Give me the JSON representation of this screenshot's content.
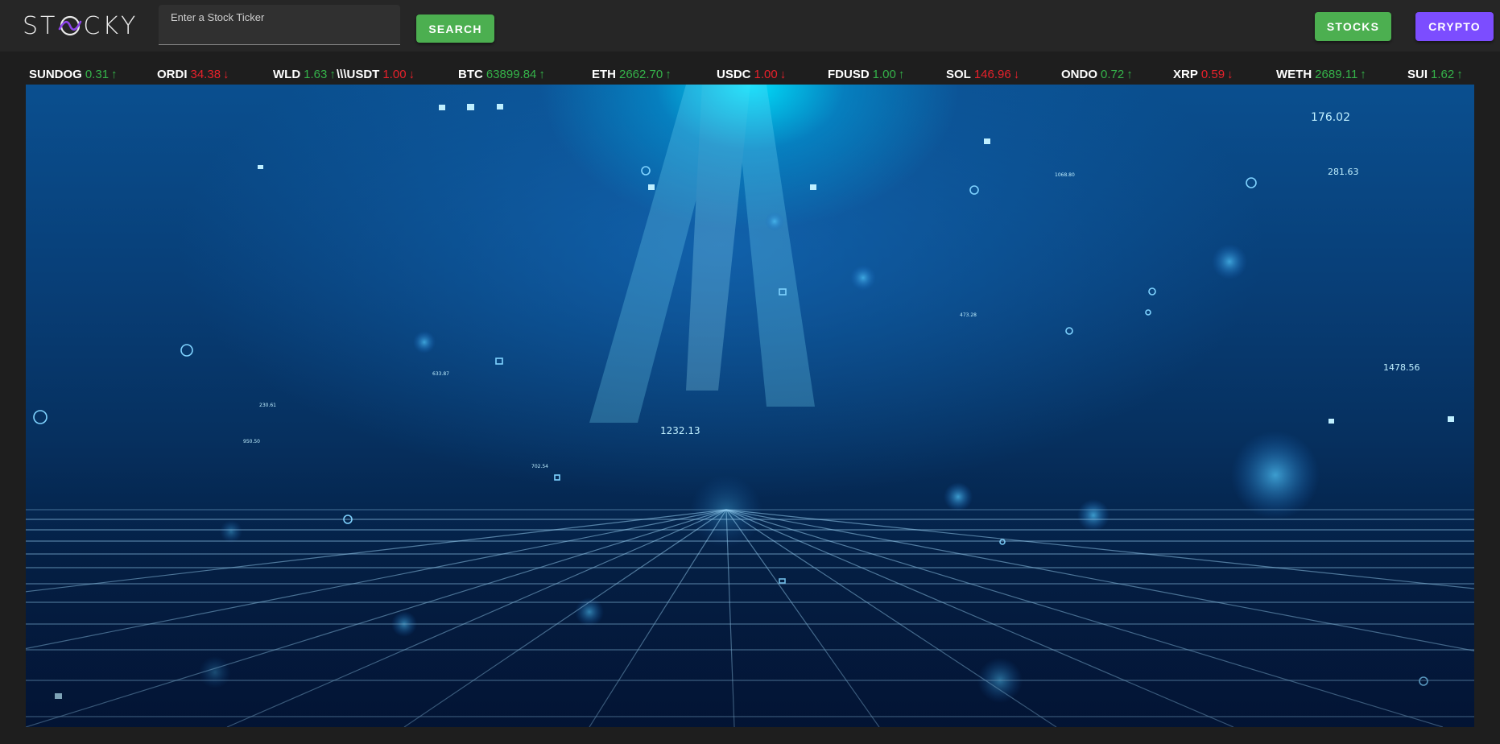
{
  "brand": {
    "logo_text_left": "ST",
    "logo_text_right": "CKY"
  },
  "search": {
    "label": "Enter a Stock Ticker",
    "value": "",
    "button_label": "SEARCH"
  },
  "nav": {
    "stocks_label": "STOCKS",
    "crypto_label": "CRYPTO",
    "colors": {
      "stocks": "#4caf50",
      "crypto": "#7c4dff"
    }
  },
  "ticker": [
    {
      "symbol": "SUNDOG",
      "value": "0.31",
      "trend": "up",
      "arrow": "↑"
    },
    {
      "symbol": "ORDI",
      "value": "34.38",
      "trend": "down",
      "arrow": "↓"
    },
    {
      "symbol": "WLD",
      "value": "1.63",
      "trend": "up",
      "arrow": "↑"
    },
    {
      "symbol": "\\\\\\USDT",
      "value": "1.00",
      "trend": "down",
      "arrow": "↓"
    },
    {
      "symbol": "BTC",
      "value": "63899.84",
      "trend": "up",
      "arrow": "↑"
    },
    {
      "symbol": "ETH",
      "value": "2662.70",
      "trend": "up",
      "arrow": "↑"
    },
    {
      "symbol": "USDC",
      "value": "1.00",
      "trend": "down",
      "arrow": "↓"
    },
    {
      "symbol": "FDUSD",
      "value": "1.00",
      "trend": "up",
      "arrow": "↑"
    },
    {
      "symbol": "SOL",
      "value": "146.96",
      "trend": "down",
      "arrow": "↓"
    },
    {
      "symbol": "ONDO",
      "value": "0.72",
      "trend": "up",
      "arrow": "↑"
    },
    {
      "symbol": "XRP",
      "value": "0.59",
      "trend": "down",
      "arrow": "↓"
    },
    {
      "symbol": "WETH",
      "value": "2689.11",
      "trend": "up",
      "arrow": "↑"
    },
    {
      "symbol": "SUI",
      "value": "1.62",
      "trend": "up",
      "arrow": "↑"
    }
  ],
  "hero": {
    "floating_numbers": [
      "176.02",
      "281.63",
      "1478.56",
      "1232.13",
      "633.87",
      "230.61",
      "950.50",
      "702.54",
      "473.28",
      "1068.80"
    ]
  },
  "colors": {
    "up": "#35b34a",
    "down": "#e8212b",
    "navbar": "#262626",
    "page": "#1e1e1e"
  }
}
